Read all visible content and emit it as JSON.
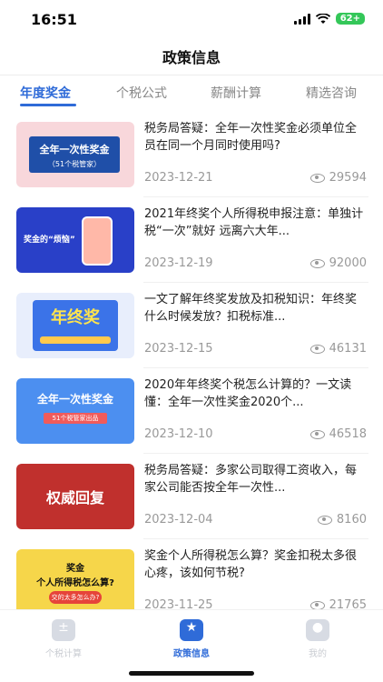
{
  "status": {
    "time": "16:51",
    "battery": "62+"
  },
  "header": {
    "title": "政策信息"
  },
  "tabs": [
    {
      "label": "年度奖金",
      "active": true
    },
    {
      "label": "个税公式",
      "active": false
    },
    {
      "label": "薪酬计算",
      "active": false
    },
    {
      "label": "精选咨询",
      "active": false
    }
  ],
  "articles": [
    {
      "title": "税务局答疑：全年一次性奖金必须单位全员在同一个月同时使用吗?",
      "date": "2023-12-21",
      "views": "29594",
      "thumb": {
        "line1": "全年一次性奖金",
        "line2": "（51个税管家）"
      }
    },
    {
      "title": "2021年终奖个人所得税申报注意：单独计税“一次”就好 远离六大年...",
      "date": "2023-12-19",
      "views": "92000",
      "thumb": {
        "line1": "奖金的“烦恼”"
      }
    },
    {
      "title": "一文了解年终奖发放及扣税知识：年终奖什么时候发放？扣税标准...",
      "date": "2023-12-15",
      "views": "46131",
      "thumb": {
        "line1": "年终奖"
      }
    },
    {
      "title": "2020年年终奖个税怎么计算的？一文读懂：全年一次性奖金2020个...",
      "date": "2023-12-10",
      "views": "46518",
      "thumb": {
        "line1": "全年一次性奖金",
        "line2": "51个税管家出品"
      }
    },
    {
      "title": "税务局答疑：多家公司取得工资收入，每家公司能否按全年一次性...",
      "date": "2023-12-04",
      "views": "8160",
      "thumb": {
        "line1": "权威回复"
      }
    },
    {
      "title": "奖金个人所得税怎么算？奖金扣税太多很心疼，该如何节税?",
      "date": "2023-11-25",
      "views": "21765",
      "thumb": {
        "line1": "奖金",
        "line2": "个人所得税怎么算?",
        "line3": "交的太多怎么办?"
      }
    }
  ],
  "tabbar": [
    {
      "label": "个税计算",
      "icon": "calculator-icon",
      "active": false
    },
    {
      "label": "政策信息",
      "icon": "star-icon",
      "active": true
    },
    {
      "label": "我的",
      "icon": "user-icon",
      "active": false
    }
  ],
  "colors": {
    "accent": "#2f6bd8"
  }
}
